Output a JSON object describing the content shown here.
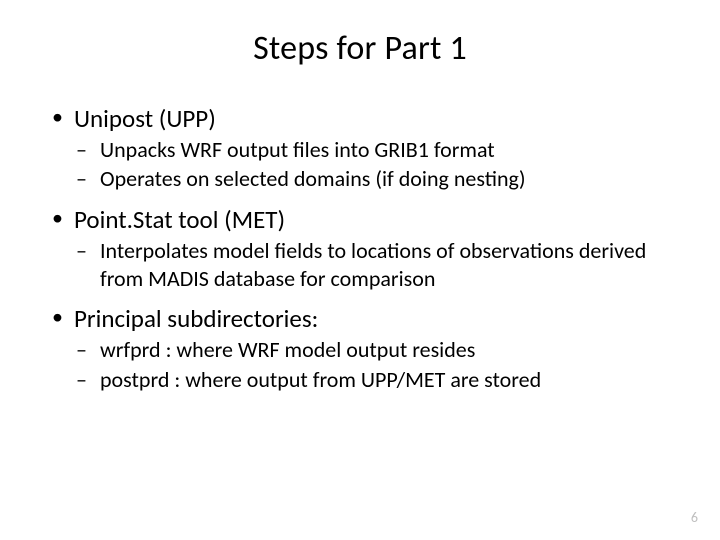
{
  "title": "Steps for Part 1",
  "items": [
    {
      "label": "Unipost (UPP)",
      "sub": [
        "Unpacks WRF output files into GRIB1 format",
        "Operates on selected domains (if doing nesting)"
      ]
    },
    {
      "label": "Point.Stat tool (MET)",
      "sub": [
        "Interpolates model fields to locations of observations derived from MADIS database for comparison"
      ]
    },
    {
      "label": "Principal subdirectories:",
      "sub": [
        "wrfprd : where WRF model output resides",
        "postprd : where output from UPP/MET are stored"
      ]
    }
  ],
  "page_number": "6"
}
